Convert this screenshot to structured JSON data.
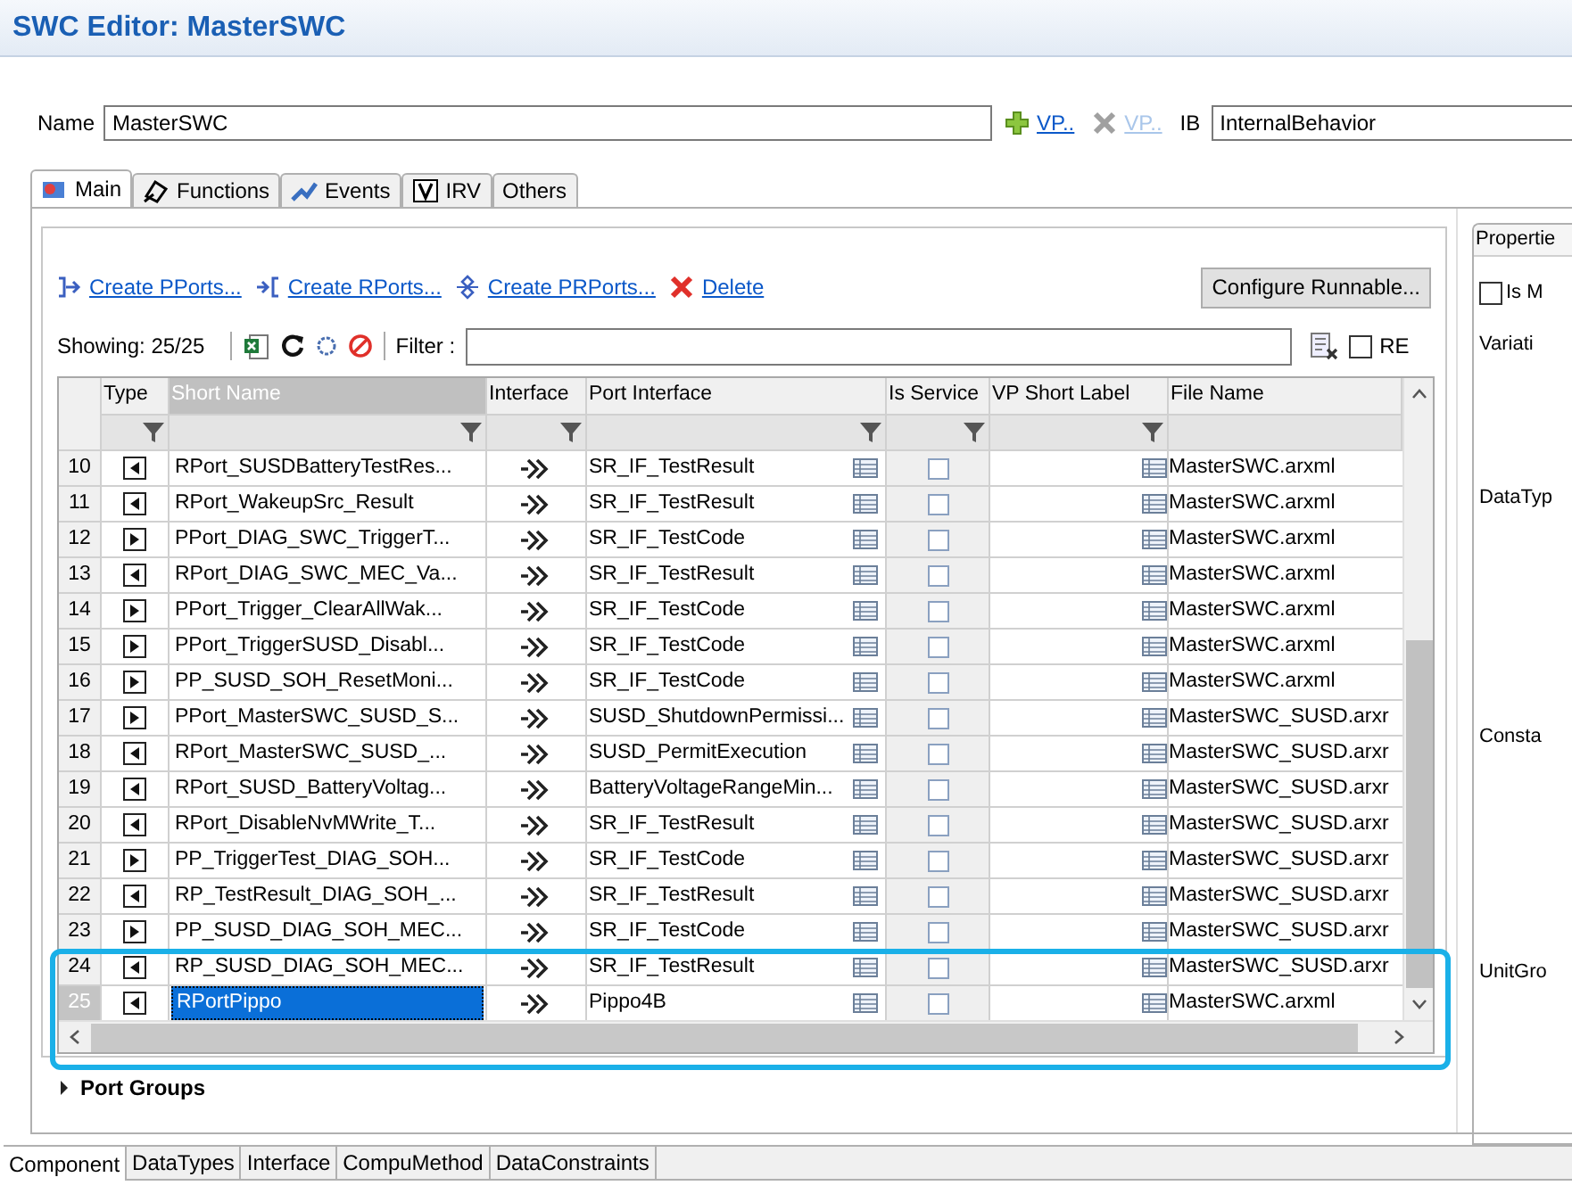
{
  "window": {
    "title": "SWC Editor: MasterSWC"
  },
  "name_row": {
    "label": "Name",
    "value": "MasterSWC",
    "add_link": {
      "label": "VP..",
      "disabled": false
    },
    "remove_link": {
      "label": "VP..",
      "disabled": true
    },
    "ib_label": "IB",
    "ib_value": "InternalBehavior"
  },
  "tabs": [
    {
      "label": "Main",
      "kind": "main",
      "selected": true
    },
    {
      "label": "Functions",
      "kind": "functions",
      "selected": false
    },
    {
      "label": "Events",
      "kind": "events",
      "selected": false
    },
    {
      "label": "IRV",
      "kind": "irv",
      "selected": false
    },
    {
      "label": "Others",
      "kind": "none",
      "selected": false
    }
  ],
  "actions": [
    {
      "kind": "pport",
      "label": "Create PPorts..."
    },
    {
      "kind": "rport",
      "label": "Create RPorts..."
    },
    {
      "kind": "prport",
      "label": "Create PRPorts..."
    },
    {
      "kind": "delete",
      "label": "Delete"
    }
  ],
  "configure_button": "Configure Runnable...",
  "toolbar": {
    "showing": "Showing: 25/25",
    "filter_label": "Filter :",
    "re": {
      "label": "RE",
      "checked": false
    }
  },
  "table": {
    "columns": [
      {
        "label": "Type",
        "sorted": false,
        "filter": true
      },
      {
        "label": "Short Name",
        "sorted": true,
        "filter": true
      },
      {
        "label": "Interface",
        "sorted": false,
        "filter": true
      },
      {
        "label": "Port Interface",
        "sorted": false,
        "filter": true
      },
      {
        "label": "Is Service",
        "sorted": false,
        "filter": true
      },
      {
        "label": "VP Short Label",
        "sorted": false,
        "filter": true
      },
      {
        "label": "File Name",
        "sorted": false,
        "filter": false
      }
    ],
    "rows": [
      {
        "number": "10",
        "kind": "in",
        "short_name": "RPort_SUSDBatteryTestRes...",
        "port_interface": "SR_IF_TestResult",
        "is_service": false,
        "file_name": "MasterSWC.arxml",
        "selected": false
      },
      {
        "number": "11",
        "kind": "in",
        "short_name": "RPort_WakeupSrc_Result",
        "port_interface": "SR_IF_TestResult",
        "is_service": false,
        "file_name": "MasterSWC.arxml",
        "selected": false
      },
      {
        "number": "12",
        "kind": "out",
        "short_name": "PPort_DIAG_SWC_TriggerT...",
        "port_interface": "SR_IF_TestCode",
        "is_service": false,
        "file_name": "MasterSWC.arxml",
        "selected": false
      },
      {
        "number": "13",
        "kind": "in",
        "short_name": "RPort_DIAG_SWC_MEC_Va...",
        "port_interface": "SR_IF_TestResult",
        "is_service": false,
        "file_name": "MasterSWC.arxml",
        "selected": false
      },
      {
        "number": "14",
        "kind": "out",
        "short_name": "PPort_Trigger_ClearAllWak...",
        "port_interface": "SR_IF_TestCode",
        "is_service": false,
        "file_name": "MasterSWC.arxml",
        "selected": false
      },
      {
        "number": "15",
        "kind": "out",
        "short_name": "PPort_TriggerSUSD_Disabl...",
        "port_interface": "SR_IF_TestCode",
        "is_service": false,
        "file_name": "MasterSWC.arxml",
        "selected": false
      },
      {
        "number": "16",
        "kind": "out",
        "short_name": "PP_SUSD_SOH_ResetMoni...",
        "port_interface": "SR_IF_TestCode",
        "is_service": false,
        "file_name": "MasterSWC.arxml",
        "selected": false
      },
      {
        "number": "17",
        "kind": "out",
        "short_name": "PPort_MasterSWC_SUSD_S...",
        "port_interface": "SUSD_ShutdownPermissi...",
        "is_service": false,
        "file_name": "MasterSWC_SUSD.arxr",
        "selected": false
      },
      {
        "number": "18",
        "kind": "in",
        "short_name": "RPort_MasterSWC_SUSD_...",
        "port_interface": "SUSD_PermitExecution",
        "is_service": false,
        "file_name": "MasterSWC_SUSD.arxr",
        "selected": false
      },
      {
        "number": "19",
        "kind": "in",
        "short_name": "RPort_SUSD_BatteryVoltag...",
        "port_interface": "BatteryVoltageRangeMin...",
        "is_service": false,
        "file_name": "MasterSWC_SUSD.arxr",
        "selected": false
      },
      {
        "number": "20",
        "kind": "in",
        "short_name": "RPort_DisableNvMWrite_T...",
        "port_interface": "SR_IF_TestResult",
        "is_service": false,
        "file_name": "MasterSWC_SUSD.arxr",
        "selected": false
      },
      {
        "number": "21",
        "kind": "out",
        "short_name": "PP_TriggerTest_DIAG_SOH...",
        "port_interface": "SR_IF_TestCode",
        "is_service": false,
        "file_name": "MasterSWC_SUSD.arxr",
        "selected": false
      },
      {
        "number": "22",
        "kind": "in",
        "short_name": "RP_TestResult_DIAG_SOH_...",
        "port_interface": "SR_IF_TestResult",
        "is_service": false,
        "file_name": "MasterSWC_SUSD.arxr",
        "selected": false
      },
      {
        "number": "23",
        "kind": "out",
        "short_name": "PP_SUSD_DIAG_SOH_MEC...",
        "port_interface": "SR_IF_TestCode",
        "is_service": false,
        "file_name": "MasterSWC_SUSD.arxr",
        "selected": false
      },
      {
        "number": "24",
        "kind": "in",
        "short_name": "RP_SUSD_DIAG_SOH_MEC...",
        "port_interface": "SR_IF_TestResult",
        "is_service": false,
        "file_name": "MasterSWC_SUSD.arxr",
        "selected": false
      },
      {
        "number": "25",
        "kind": "in",
        "short_name": "RPortPippo",
        "port_interface": "Pippo4B",
        "is_service": false,
        "file_name": "MasterSWC.arxml",
        "selected": true
      }
    ]
  },
  "port_groups": {
    "label": "Port Groups",
    "expanded": false
  },
  "properties": {
    "title": "Propertie",
    "is_m": {
      "label": "Is M",
      "checked": false
    },
    "labels": [
      "Variati",
      "DataTyp",
      "Consta",
      "UnitGro"
    ]
  },
  "bottom_tabs": [
    {
      "label": "Component",
      "selected": true
    },
    {
      "label": "DataTypes",
      "selected": false
    },
    {
      "label": "Interface",
      "selected": false
    },
    {
      "label": "CompuMethod",
      "selected": false
    },
    {
      "label": "DataConstraints",
      "selected": false
    }
  ]
}
